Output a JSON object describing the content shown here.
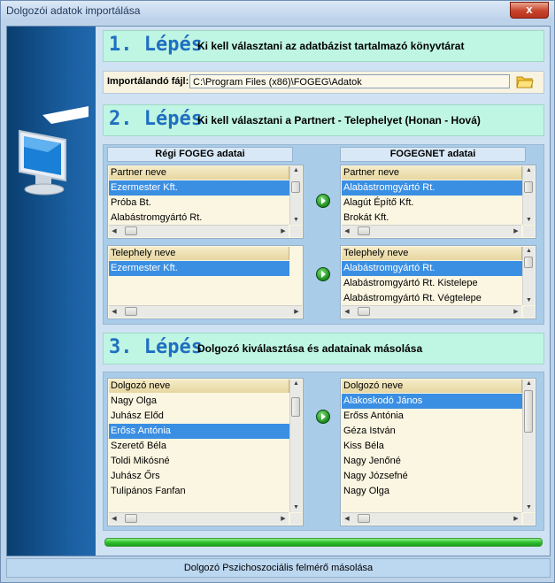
{
  "window": {
    "title": "Dolgozói adatok importálása",
    "close_label": "x"
  },
  "step1": {
    "number": "1. Lépés",
    "description": "Ki kell választani az adatbázist tartalmazó könyvtárat"
  },
  "file": {
    "label": "Importálandó fájl:",
    "value": "C:\\Program Files (x86)\\FOGEG\\Adatok"
  },
  "step2": {
    "number": "2. Lépés",
    "description": "Ki kell választani a Partnert - Telephelyet (Honan - Hová)"
  },
  "columns": {
    "left": "Régi FOGEG adatai",
    "right": "FOGEGNET adatai"
  },
  "partner_left": {
    "header": "Partner neve",
    "rows": [
      "Ezermester Kft.",
      "Próba Bt.",
      "Alabástromgyártó Rt."
    ],
    "selected": 0
  },
  "partner_right": {
    "header": "Partner neve",
    "rows": [
      "Alabástromgyártó Rt.",
      "Alagút Építő Kft.",
      "Brokát Kft."
    ],
    "selected": 0
  },
  "site_left": {
    "header": "Telephely neve",
    "rows": [
      "Ezermester Kft."
    ],
    "selected": 0
  },
  "site_right": {
    "header": "Telephely neve",
    "rows": [
      "Alabástromgyártó Rt.",
      "Alabástromgyártó Rt. Kistelepe",
      "Alabástromgyártó Rt. Végtelepe"
    ],
    "selected": 0
  },
  "step3": {
    "number": "3. Lépés",
    "description": "Dolgozó kiválasztása és adatainak másolása"
  },
  "emp_left": {
    "header": "Dolgozó neve",
    "rows": [
      "Nagy Olga",
      "Juhász Előd",
      "Erőss Antónia",
      "Szerető Béla",
      "Toldi Mikósné",
      "Juhász Őrs",
      "Tulipános Fanfan"
    ],
    "selected": 2
  },
  "emp_right": {
    "header": "Dolgozó neve",
    "rows": [
      "Alakoskodó János",
      "Erőss Antónia",
      "Géza István",
      "Kiss Béla",
      "Nagy Jenőné",
      "Nagy Józsefné",
      "Nagy Olga"
    ],
    "selected": 0
  },
  "progress": {
    "percent": 100
  },
  "status": {
    "text": "Dolgozó Pszichoszociális felmérő másolása"
  },
  "colors": {
    "accent": "#1f6fc0",
    "selection": "#3a8fe3",
    "step_bg": "#bff5e3",
    "progress": "#2fc12d"
  }
}
